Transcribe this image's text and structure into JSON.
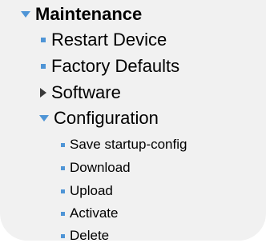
{
  "menu": {
    "title": "Maintenance",
    "items": [
      {
        "label": "Restart Device"
      },
      {
        "label": "Factory Defaults"
      },
      {
        "label": "Software"
      },
      {
        "label": "Configuration",
        "children": [
          {
            "label": "Save startup-config"
          },
          {
            "label": "Download"
          },
          {
            "label": "Upload"
          },
          {
            "label": "Activate"
          },
          {
            "label": "Delete"
          }
        ]
      }
    ]
  },
  "icons": {
    "expanded": "triangle-down-icon",
    "collapsed": "triangle-right-icon",
    "bullet": "square-bullet-icon"
  },
  "colors": {
    "accent": "#4f95d6",
    "panel_background": "#f1f1f1",
    "collapsed_arrow": "#3a3a3a"
  }
}
